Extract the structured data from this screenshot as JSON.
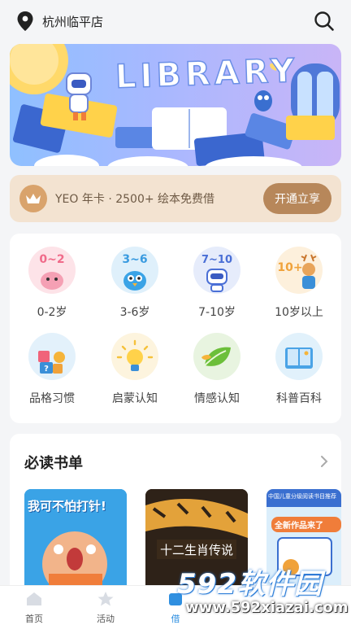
{
  "header": {
    "location": "杭州临平店",
    "location_icon": "location-pin-icon",
    "search_icon": "search-icon"
  },
  "banner": {
    "title": "LIBRARY"
  },
  "vip": {
    "text": "YEO 年卡 · 2500+ 绘本免费借",
    "button": "开通立享",
    "icon": "crown-icon"
  },
  "categories": [
    {
      "label": "0-2岁",
      "badge": "0~2",
      "icon": "pink-bird-icon",
      "bg": "#fde3e8",
      "color": "#f06b8a"
    },
    {
      "label": "3-6岁",
      "badge": "3~6",
      "icon": "blue-bird-icon",
      "bg": "#dff0fb",
      "color": "#3a9be0"
    },
    {
      "label": "7-10岁",
      "badge": "7~10",
      "icon": "robot-icon",
      "bg": "#e6ecfb",
      "color": "#4a6fd6"
    },
    {
      "label": "10岁以上",
      "badge": "10+",
      "icon": "deer-icon",
      "bg": "#fdf0dc",
      "color": "#f0a23a"
    },
    {
      "label": "品格习惯",
      "icon": "puzzle-blocks-icon",
      "bg": "#e3f1fb"
    },
    {
      "label": "启蒙认知",
      "icon": "lightbulb-icon",
      "bg": "#fdf4de"
    },
    {
      "label": "情感认知",
      "icon": "leaf-icon",
      "bg": "#e8f4e0"
    },
    {
      "label": "科普百科",
      "icon": "open-book-icon",
      "bg": "#e1f1fb"
    }
  ],
  "book_list": {
    "title": "必读书单",
    "more_icon": "chevron-right-icon",
    "books": [
      {
        "title": "我可不怕打针!"
      },
      {
        "title": "十二生肖传说"
      },
      {
        "title": "全新作品来了",
        "top_text": "中国儿童分级阅读书目推荐"
      }
    ]
  },
  "tabbar": {
    "items": [
      {
        "label": "首页",
        "icon": "home-icon"
      },
      {
        "label": "活动",
        "icon": "star-icon"
      },
      {
        "label": "借",
        "icon": "borrow-icon",
        "active": true
      }
    ]
  },
  "watermark": {
    "brand": "592软件园",
    "url": "www.592xiazai.com"
  }
}
